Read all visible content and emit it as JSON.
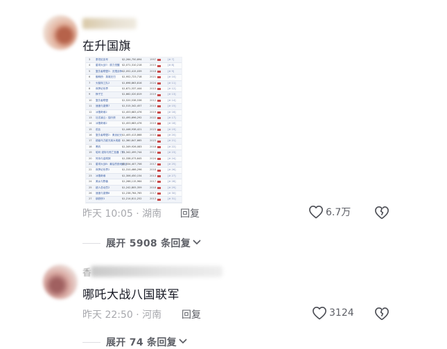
{
  "comments": [
    {
      "username": "",
      "text": "在升国旗",
      "time_location": "昨天 10:05 · 湖南",
      "reply_label": "回复",
      "likes": "6.7万",
      "expand_label": "展开 5908 条回复",
      "has_image": true
    },
    {
      "username": "香",
      "text": "哪吒大战八国联军",
      "time_location": "昨天 22:50 · 河南",
      "reply_label": "回复",
      "likes": "3124",
      "expand_label": "展开 74 条回复"
    }
  ],
  "thumbnail_table": {
    "rows": [
      {
        "rank": "3",
        "title": "泰坦尼克号",
        "gross": "$2,264,750,694",
        "year": "1997",
        "ref": "[# 7]"
      },
      {
        "rank": "4",
        "title": "星球大战7：原力觉醒",
        "gross": "$2,071,310,218",
        "year": "2015",
        "ref": "[# 8]"
      },
      {
        "rank": "5",
        "title": "复仇者联盟3：无限战争",
        "gross": "$2,052,415,039",
        "year": "2018",
        "ref": "[# 9]"
      },
      {
        "rank": "6",
        "title": "蜘蛛侠：英雄无归",
        "gross": "$1,952,723,718",
        "year": "2021",
        "ref": "[# 10]"
      },
      {
        "rank": "7",
        "title": "头脑特工队2",
        "gross": "$1,698,863,816",
        "year": "2024",
        "ref": "[# 11]"
      },
      {
        "rank": "8",
        "title": "侏罗纪世界",
        "gross": "$1,671,537,444",
        "year": "2015",
        "ref": "[# 12]"
      },
      {
        "rank": "9",
        "title": "狮子王",
        "gross": "$1,662,020,819",
        "year": "2019",
        "ref": "[# 13]"
      },
      {
        "rank": "10",
        "title": "复仇者联盟",
        "gross": "$1,520,538,536",
        "year": "2012",
        "ref": "[# 14]"
      },
      {
        "rank": "11",
        "title": "速度与激情7",
        "gross": "$1,515,342,457",
        "year": "2015",
        "ref": "[# 15]"
      },
      {
        "rank": "12",
        "title": "冰雪奇缘2",
        "gross": "$1,453,683,476",
        "year": "2019",
        "ref": "[# 16]"
      },
      {
        "rank": "13",
        "title": "壮志凌云：独行侠",
        "gross": "$1,495,696,292",
        "year": "2022",
        "ref": "[# 17]"
      },
      {
        "rank": "14",
        "title": "冰雪奇缘2",
        "gross": "$1,453,683,476",
        "year": "2019",
        "ref": "[# 18]"
      },
      {
        "rank": "15",
        "title": "芭比",
        "gross": "$1,446,938,421",
        "year": "2023",
        "ref": "[# 19]"
      },
      {
        "rank": "16",
        "title": "复仇者联盟2：奥创纪元",
        "gross": "$1,405,413,868",
        "year": "2015",
        "ref": "[# 20]"
      },
      {
        "rank": "17",
        "title": "超级马力欧兄弟大电影",
        "gross": "$1,360,847,665",
        "year": "2023",
        "ref": "[# 21]"
      },
      {
        "rank": "18",
        "title": "黑豹",
        "gross": "$1,349,926,083",
        "year": "2018",
        "ref": "[# 22]"
      },
      {
        "rank": "19",
        "title": "哈利·波特与死亡圣器（下）",
        "gross": "$1,342,499,744",
        "year": "2011",
        "ref": "[# 23]"
      },
      {
        "rank": "20",
        "title": "死侍与金刚狼",
        "gross": "$1,338,073,645",
        "year": "2024",
        "ref": "[# 24]"
      },
      {
        "rank": "21",
        "title": "星球大战8：最后的绝地武士",
        "gross": "$1,334,407,706",
        "year": "2017",
        "ref": "[# 25]"
      },
      {
        "rank": "22",
        "title": "侏罗纪世界2",
        "gross": "$1,310,466,296",
        "year": "2018",
        "ref": "[# 26]"
      },
      {
        "rank": "23",
        "title": "冰雪奇缘",
        "gross": "$1,306,450,154",
        "year": "2013",
        "ref": "[# 27]"
      },
      {
        "rank": "24",
        "title": "美女与野兽",
        "gross": "$1,266,115,964",
        "year": "2017",
        "ref": "[# 28]"
      },
      {
        "rank": "25",
        "title": "超人总动员2",
        "gross": "$1,242,805,359",
        "year": "2018",
        "ref": "[# 29]"
      },
      {
        "rank": "26",
        "title": "速度与激情8",
        "gross": "$1,238,764,765",
        "year": "2017",
        "ref": "[# 30]"
      },
      {
        "rank": "27",
        "title": "钢铁侠3",
        "gross": "$1,214,811,252",
        "year": "2013",
        "ref": "[# 31]"
      },
      {
        "rank": "28",
        "title": "小黄人大眼萌",
        "gross": "$1,159,457,503",
        "year": "2015",
        "ref": "[# 32]"
      },
      {
        "rank": "29",
        "title": "美国队长3",
        "gross": "$1,155,046,416",
        "year": "2016",
        "ref": "[# 33]"
      },
      {
        "rank": "30",
        "title": "海王",
        "gross": "$1,152,028,393",
        "year": "2018",
        "ref": "[# 34]"
      }
    ]
  },
  "colors": {
    "text_primary": "#161823",
    "text_meta": "#a7a8ad",
    "text_action": "#5d5f66",
    "link_blue": "#3a5ea5"
  },
  "icons": {
    "like": "heart-outline-icon",
    "dislike": "broken-heart-icon",
    "expand": "chevron-down-icon"
  }
}
